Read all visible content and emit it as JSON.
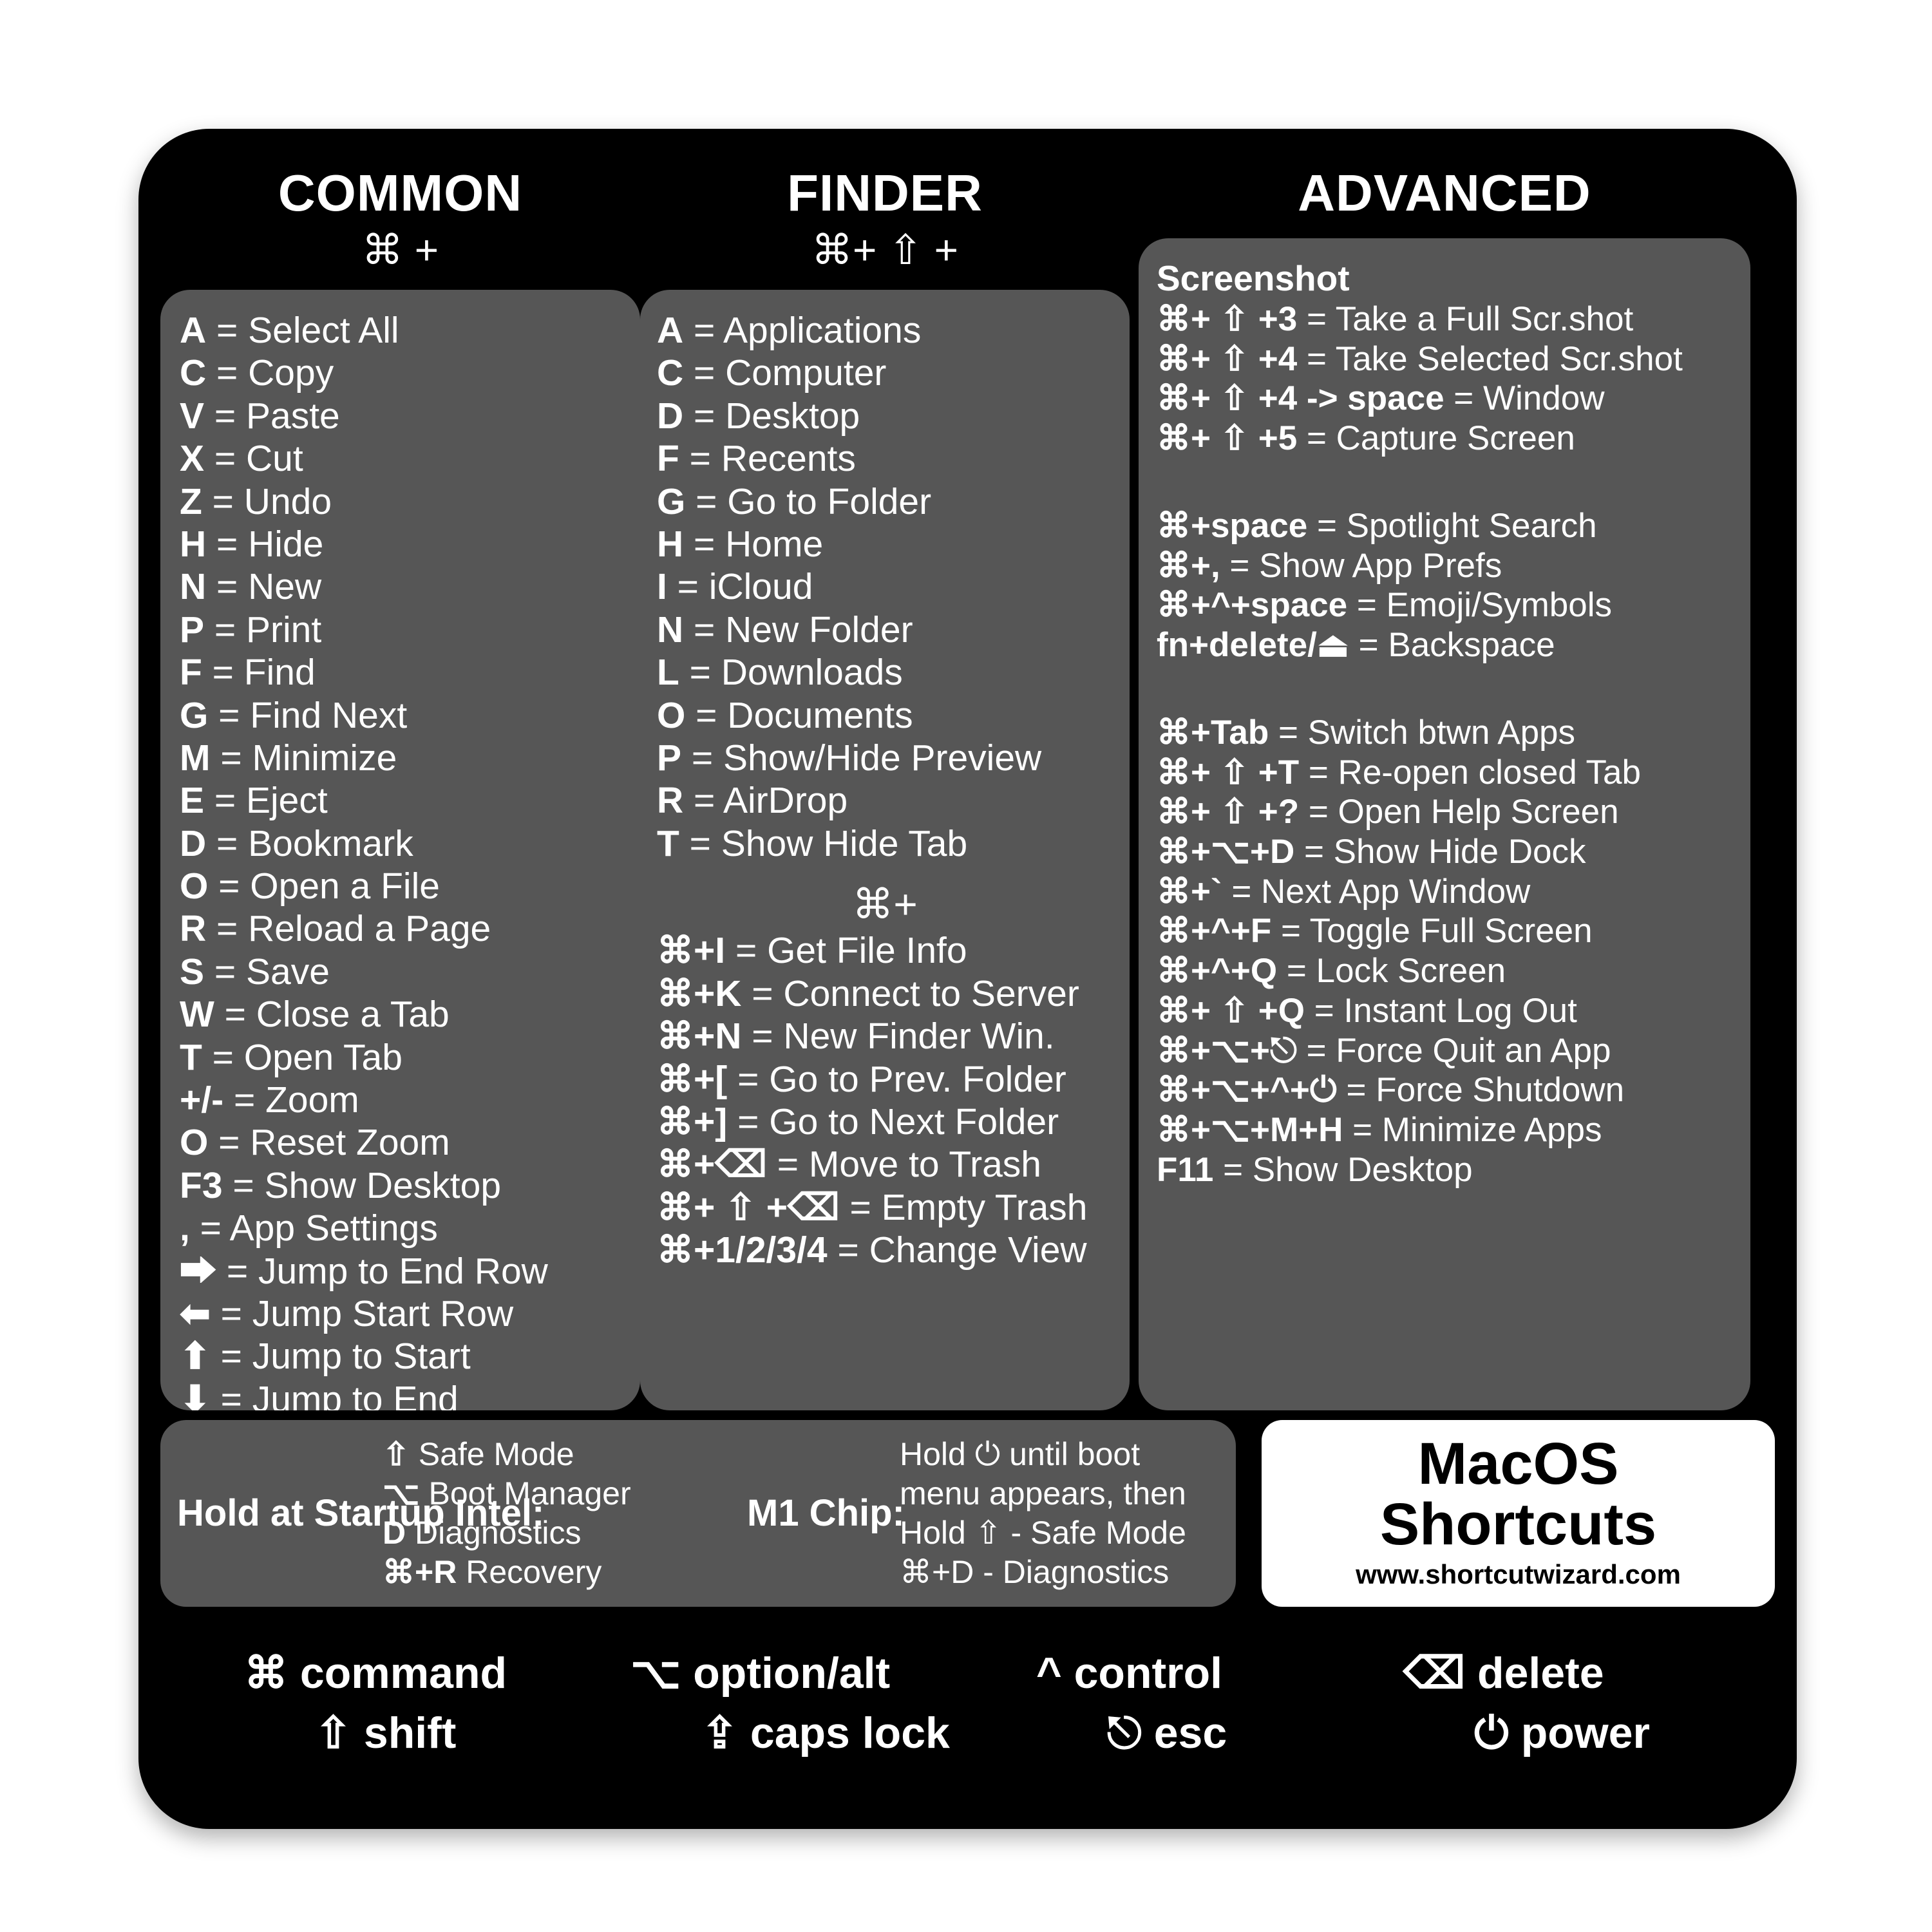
{
  "card": {
    "background": "#000000",
    "panel_background": "#565656",
    "text_color": "#ffffff"
  },
  "columns": [
    {
      "id": "common",
      "title": "COMMON",
      "subtitle": "⌘ +",
      "items": [
        {
          "key": "A",
          "desc": "= Select All"
        },
        {
          "key": "C",
          "desc": "= Copy"
        },
        {
          "key": "V",
          "desc": "= Paste"
        },
        {
          "key": "X",
          "desc": "= Cut"
        },
        {
          "key": "Z",
          "desc": "= Undo"
        },
        {
          "key": "H",
          "desc": "= Hide"
        },
        {
          "key": "N",
          "desc": "= New"
        },
        {
          "key": "P",
          "desc": "= Print"
        },
        {
          "key": "F",
          "desc": "= Find"
        },
        {
          "key": "G",
          "desc": "= Find Next"
        },
        {
          "key": "M",
          "desc": "= Minimize"
        },
        {
          "key": "E",
          "desc": "= Eject"
        },
        {
          "key": "D",
          "desc": "= Bookmark"
        },
        {
          "key": "O",
          "desc": "= Open a File"
        },
        {
          "key": "R",
          "desc": "= Reload a Page"
        },
        {
          "key": "S",
          "desc": "= Save"
        },
        {
          "key": "W",
          "desc": "= Close a Tab"
        },
        {
          "key": "T",
          "desc": "= Open Tab"
        },
        {
          "key": "+/-",
          "desc": "= Zoom"
        },
        {
          "key": "O",
          "desc": "= Reset Zoom"
        },
        {
          "key": "F3",
          "desc": "= Show Desktop"
        },
        {
          "key": ",",
          "desc": "= App Settings"
        },
        {
          "key": "⮕",
          "desc": "= Jump to End Row"
        },
        {
          "key": "⬅",
          "desc": "= Jump Start Row"
        },
        {
          "key": "⬆",
          "desc": "= Jump to Start"
        },
        {
          "key": "⬇",
          "desc": "= Jump to End"
        }
      ]
    },
    {
      "id": "finder",
      "title": "FINDER",
      "subtitle": "⌘+ ⇧ +",
      "items": [
        {
          "key": "A",
          "desc": "= Applications"
        },
        {
          "key": "C",
          "desc": "= Computer"
        },
        {
          "key": "D",
          "desc": "= Desktop"
        },
        {
          "key": "F",
          "desc": "= Recents"
        },
        {
          "key": "G",
          "desc": "= Go to Folder"
        },
        {
          "key": "H",
          "desc": "= Home"
        },
        {
          "key": "I",
          "desc": "= iCloud"
        },
        {
          "key": "N",
          "desc": "= New Folder"
        },
        {
          "key": "L",
          "desc": "= Downloads"
        },
        {
          "key": "O",
          "desc": "= Documents"
        },
        {
          "key": "P",
          "desc": "= Show/Hide Preview"
        },
        {
          "key": "R",
          "desc": "= AirDrop"
        },
        {
          "key": "T",
          "desc": "= Show Hide Tab"
        }
      ],
      "mid_symbol": "⌘+",
      "items2": [
        {
          "key": "⌘+I",
          "desc": "= Get File Info"
        },
        {
          "key": "⌘+K",
          "desc": "= Connect to Server"
        },
        {
          "key": "⌘+N",
          "desc": "= New Finder Win."
        },
        {
          "key": "⌘+[",
          "desc": "= Go to Prev. Folder"
        },
        {
          "key": "⌘+]",
          "desc": "= Go to Next Folder"
        },
        {
          "key": "⌘+⌫",
          "desc": "= Move to Trash"
        },
        {
          "key": "⌘+ ⇧ +⌫",
          "desc": "= Empty Trash"
        },
        {
          "key": "⌘+1/2/3/4",
          "desc": "= Change View"
        }
      ]
    },
    {
      "id": "advanced",
      "title": "ADVANCED",
      "subtitle": "",
      "section_title": "Screenshot",
      "items": [
        {
          "key": "⌘+ ⇧ +3",
          "desc": "= Take a Full Scr.shot"
        },
        {
          "key": "⌘+ ⇧ +4",
          "desc": "= Take Selected Scr.shot"
        },
        {
          "key": "⌘+ ⇧ +4 -> space",
          "desc": "= Window"
        },
        {
          "key": "⌘+ ⇧ +5",
          "desc": "= Capture Screen"
        }
      ],
      "items2": [
        {
          "key": "⌘+space",
          "desc": "= Spotlight Search"
        },
        {
          "key": "⌘+,",
          "desc": "= Show App Prefs"
        },
        {
          "key": "⌘+^+space",
          "desc": "= Emoji/Symbols"
        },
        {
          "key": "fn+delete/⏏",
          "desc": "= Backspace"
        }
      ],
      "items3": [
        {
          "key": "⌘+Tab",
          "desc": "= Switch btwn Apps"
        },
        {
          "key": "⌘+ ⇧ +T",
          "desc": "= Re-open closed Tab"
        },
        {
          "key": "⌘+ ⇧ +?",
          "desc": "= Open Help Screen"
        },
        {
          "key": "⌘+⌥+D",
          "desc": "= Show Hide Dock"
        },
        {
          "key": "⌘+`",
          "desc": "= Next App Window"
        },
        {
          "key": "⌘+^+F",
          "desc": "= Toggle Full Screen"
        },
        {
          "key": "⌘+^+Q",
          "desc": "=  Lock Screen"
        },
        {
          "key": "⌘+ ⇧ +Q",
          "desc": "= Instant Log Out"
        },
        {
          "key": "⌘+⌥+⎋",
          "desc": "= Force Quit an App"
        },
        {
          "key": "⌘+⌥+^+⏻",
          "desc": "= Force Shutdown"
        },
        {
          "key": "⌘+⌥+M+H",
          "desc": "= Minimize Apps"
        },
        {
          "key": "F11",
          "desc": "= Show Desktop"
        }
      ]
    }
  ],
  "startup": {
    "intel_label": "Hold at Startup Intel:",
    "intel_items": [
      {
        "key": "⇧",
        "desc": "Safe Mode"
      },
      {
        "key": "⌥",
        "desc": "Boot Manager"
      },
      {
        "key": "D",
        "desc": "Diagnostics"
      },
      {
        "key": "⌘+R",
        "desc": "Recovery"
      }
    ],
    "m1_label": "M1 Chip:",
    "m1_items": [
      {
        "text": "Hold  ⏻ until boot"
      },
      {
        "text": "menu appears, then"
      },
      {
        "text": "Hold ⇧ - Safe Mode"
      },
      {
        "text": "⌘+D - Diagnostics"
      }
    ]
  },
  "logo": {
    "line1": "MacOS",
    "line2": "Shortcuts",
    "url": "www.shortcutwizard.com"
  },
  "legend": {
    "row1": [
      {
        "sym": "⌘",
        "label": "command"
      },
      {
        "sym": "⌥",
        "label": "option/alt"
      },
      {
        "sym": "^",
        "label": "control"
      },
      {
        "sym": "⌫",
        "label": "delete"
      }
    ],
    "row2": [
      {
        "sym": "⇧",
        "label": "shift"
      },
      {
        "sym": "⇪",
        "label": "caps lock"
      },
      {
        "sym": "⎋",
        "label": "esc"
      },
      {
        "sym": "⏻",
        "label": "power"
      }
    ]
  }
}
